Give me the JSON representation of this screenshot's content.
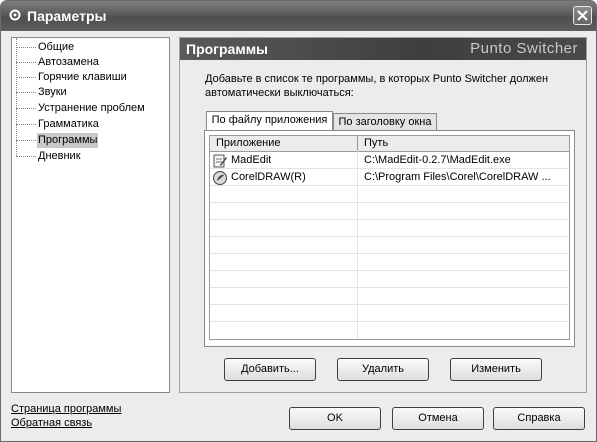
{
  "window": {
    "title": "Параметры"
  },
  "nav": {
    "items": [
      {
        "label": "Общие"
      },
      {
        "label": "Автозамена"
      },
      {
        "label": "Горячие клавиши"
      },
      {
        "label": "Звуки"
      },
      {
        "label": "Устранение проблем"
      },
      {
        "label": "Грамматика"
      },
      {
        "label": "Программы",
        "selected": true
      },
      {
        "label": "Дневник"
      }
    ]
  },
  "panel": {
    "title": "Программы",
    "brand": "Punto Switcher",
    "description": "Добавьте в список те программы, в которых Punto Switcher должен автоматически выключаться:",
    "tabs": [
      {
        "label": "По файлу приложения",
        "active": true
      },
      {
        "label": "По заголовку окна"
      }
    ],
    "table": {
      "columns": [
        "Приложение",
        "Путь"
      ],
      "rows": [
        {
          "app": "MadEdit",
          "path": "C:\\MadEdit-0.2.7\\MadEdit.exe",
          "icon": "madedit-icon"
        },
        {
          "app": "CorelDRAW(R)",
          "path": "C:\\Program Files\\Corel\\CorelDRAW ...",
          "icon": "coreldraw-icon"
        }
      ]
    },
    "buttons": {
      "add": "Добавить...",
      "delete": "Удалить",
      "edit": "Изменить"
    }
  },
  "footer": {
    "links": {
      "program_page": "Страница программы",
      "feedback": "Обратная связь"
    },
    "buttons": {
      "ok": "OK",
      "cancel": "Отмена",
      "help": "Справка"
    }
  }
}
